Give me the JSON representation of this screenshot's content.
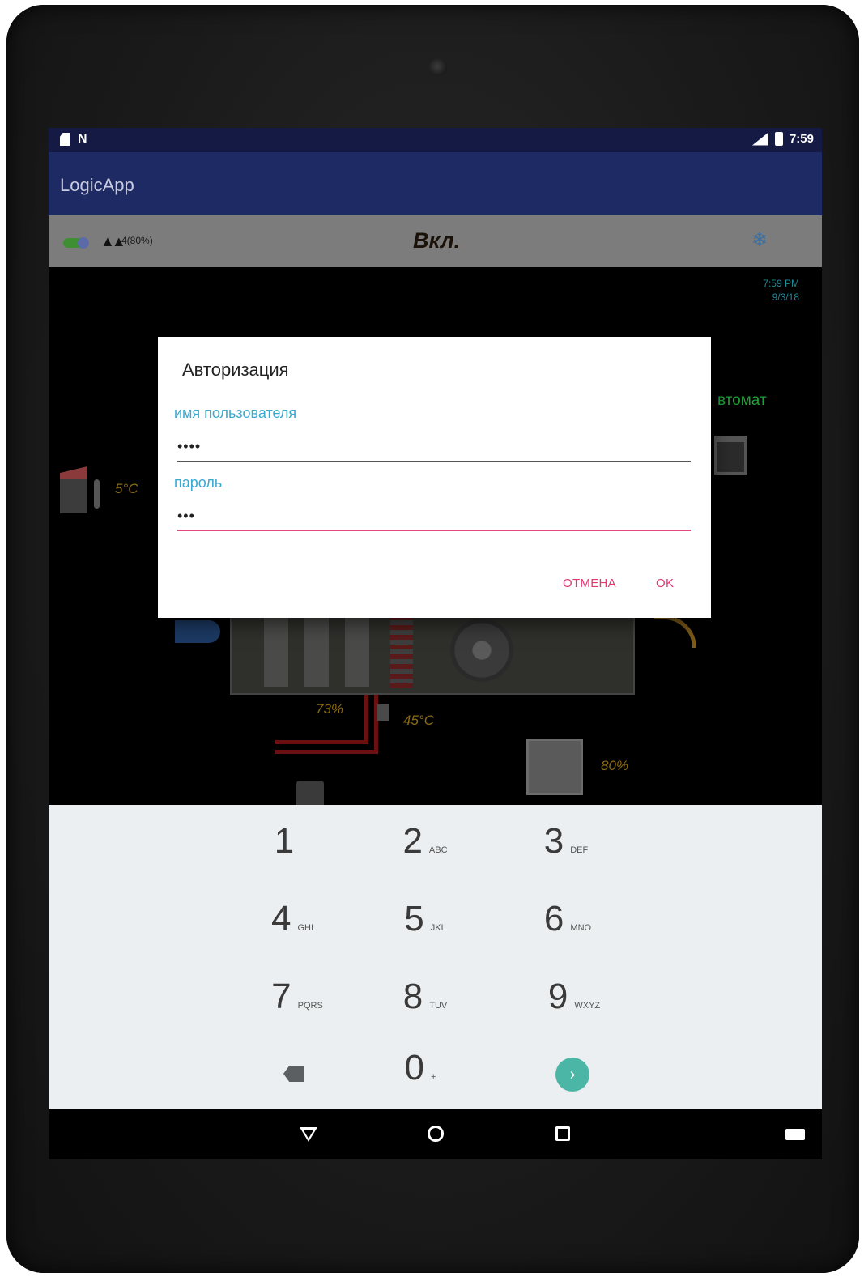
{
  "status_bar": {
    "time": "7:59"
  },
  "app_bar": {
    "title": "LogicApp"
  },
  "toolbar": {
    "fan_level": "4(80%)",
    "state": "Вкл."
  },
  "scheme": {
    "time": "7:59 PM",
    "date": "9/3/18",
    "mode": "втомат",
    "outside_temp": "5°C",
    "valve_percent": "73%",
    "water_temp": "45°C",
    "humidity_percent": "80%"
  },
  "dialog": {
    "title": "Авторизация",
    "username_label": "имя пользователя",
    "username_value": "••••",
    "password_label": "пароль",
    "password_value": "•••",
    "cancel_label": "ОТМЕНА",
    "ok_label": "OK"
  },
  "keyboard": {
    "keys": [
      {
        "digit": "1",
        "letters": ""
      },
      {
        "digit": "2",
        "letters": "ABC"
      },
      {
        "digit": "3",
        "letters": "DEF"
      },
      {
        "digit": "4",
        "letters": "GHI"
      },
      {
        "digit": "5",
        "letters": "JKL"
      },
      {
        "digit": "6",
        "letters": "MNO"
      },
      {
        "digit": "7",
        "letters": "PQRS"
      },
      {
        "digit": "8",
        "letters": "TUV"
      },
      {
        "digit": "9",
        "letters": "WXYZ"
      },
      {
        "digit": "0",
        "letters": "+"
      }
    ]
  },
  "colors": {
    "status_bar": "#151a45",
    "app_bar": "#1d2a63",
    "accent": "#e2386f",
    "label": "#3aa9cf",
    "keyboard_bg": "#eceff1",
    "go_key": "#4bb6a6"
  }
}
